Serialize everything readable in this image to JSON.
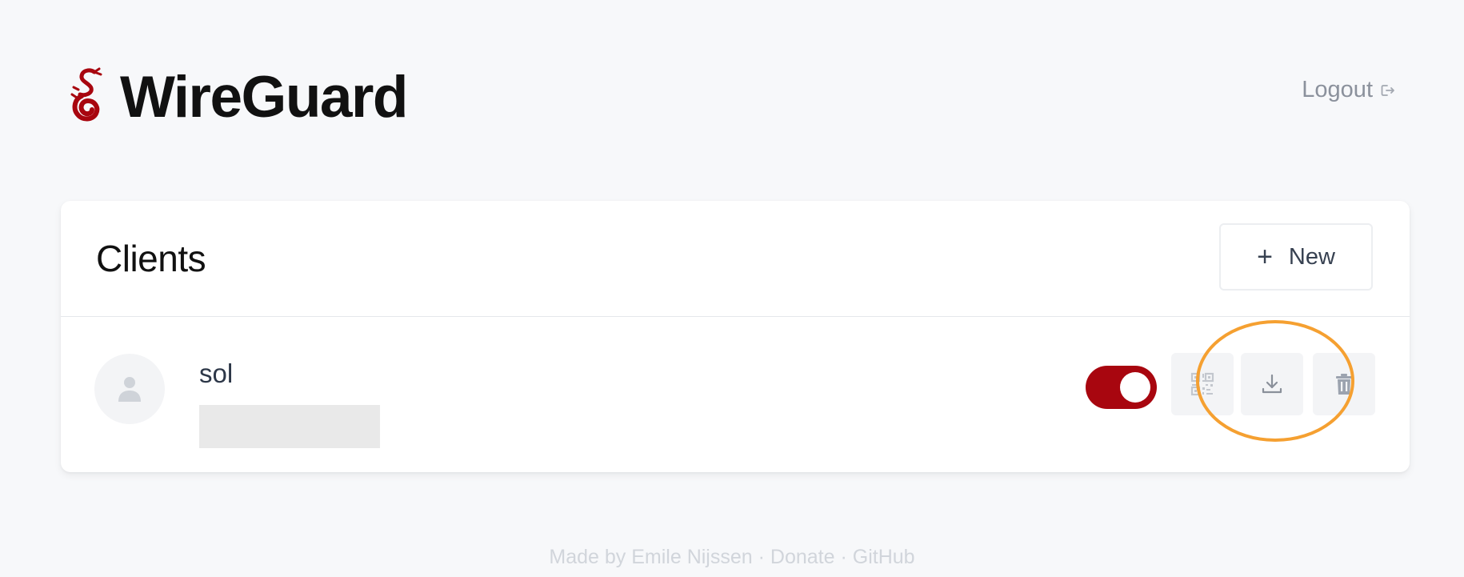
{
  "app": {
    "title": "WireGuard",
    "logo_icon": "wireguard-dragon-icon",
    "brand_color": "#a8060f"
  },
  "header": {
    "logout_label": "Logout",
    "logout_icon": "logout-icon"
  },
  "clients_card": {
    "title": "Clients",
    "new_button_icon": "plus",
    "new_button_label": "New",
    "clients": [
      {
        "name": "sol",
        "avatar_icon": "user-icon",
        "enabled": true,
        "actions": [
          "qr-code-icon",
          "download-icon",
          "trash-icon"
        ]
      }
    ]
  },
  "annotation": {
    "highlight_color": "#f5a031",
    "highlighted_action": "download-icon"
  },
  "footer": {
    "made_by": "Made by Emile Nijssen",
    "separator": "·",
    "donate": "Donate",
    "github": "GitHub"
  }
}
